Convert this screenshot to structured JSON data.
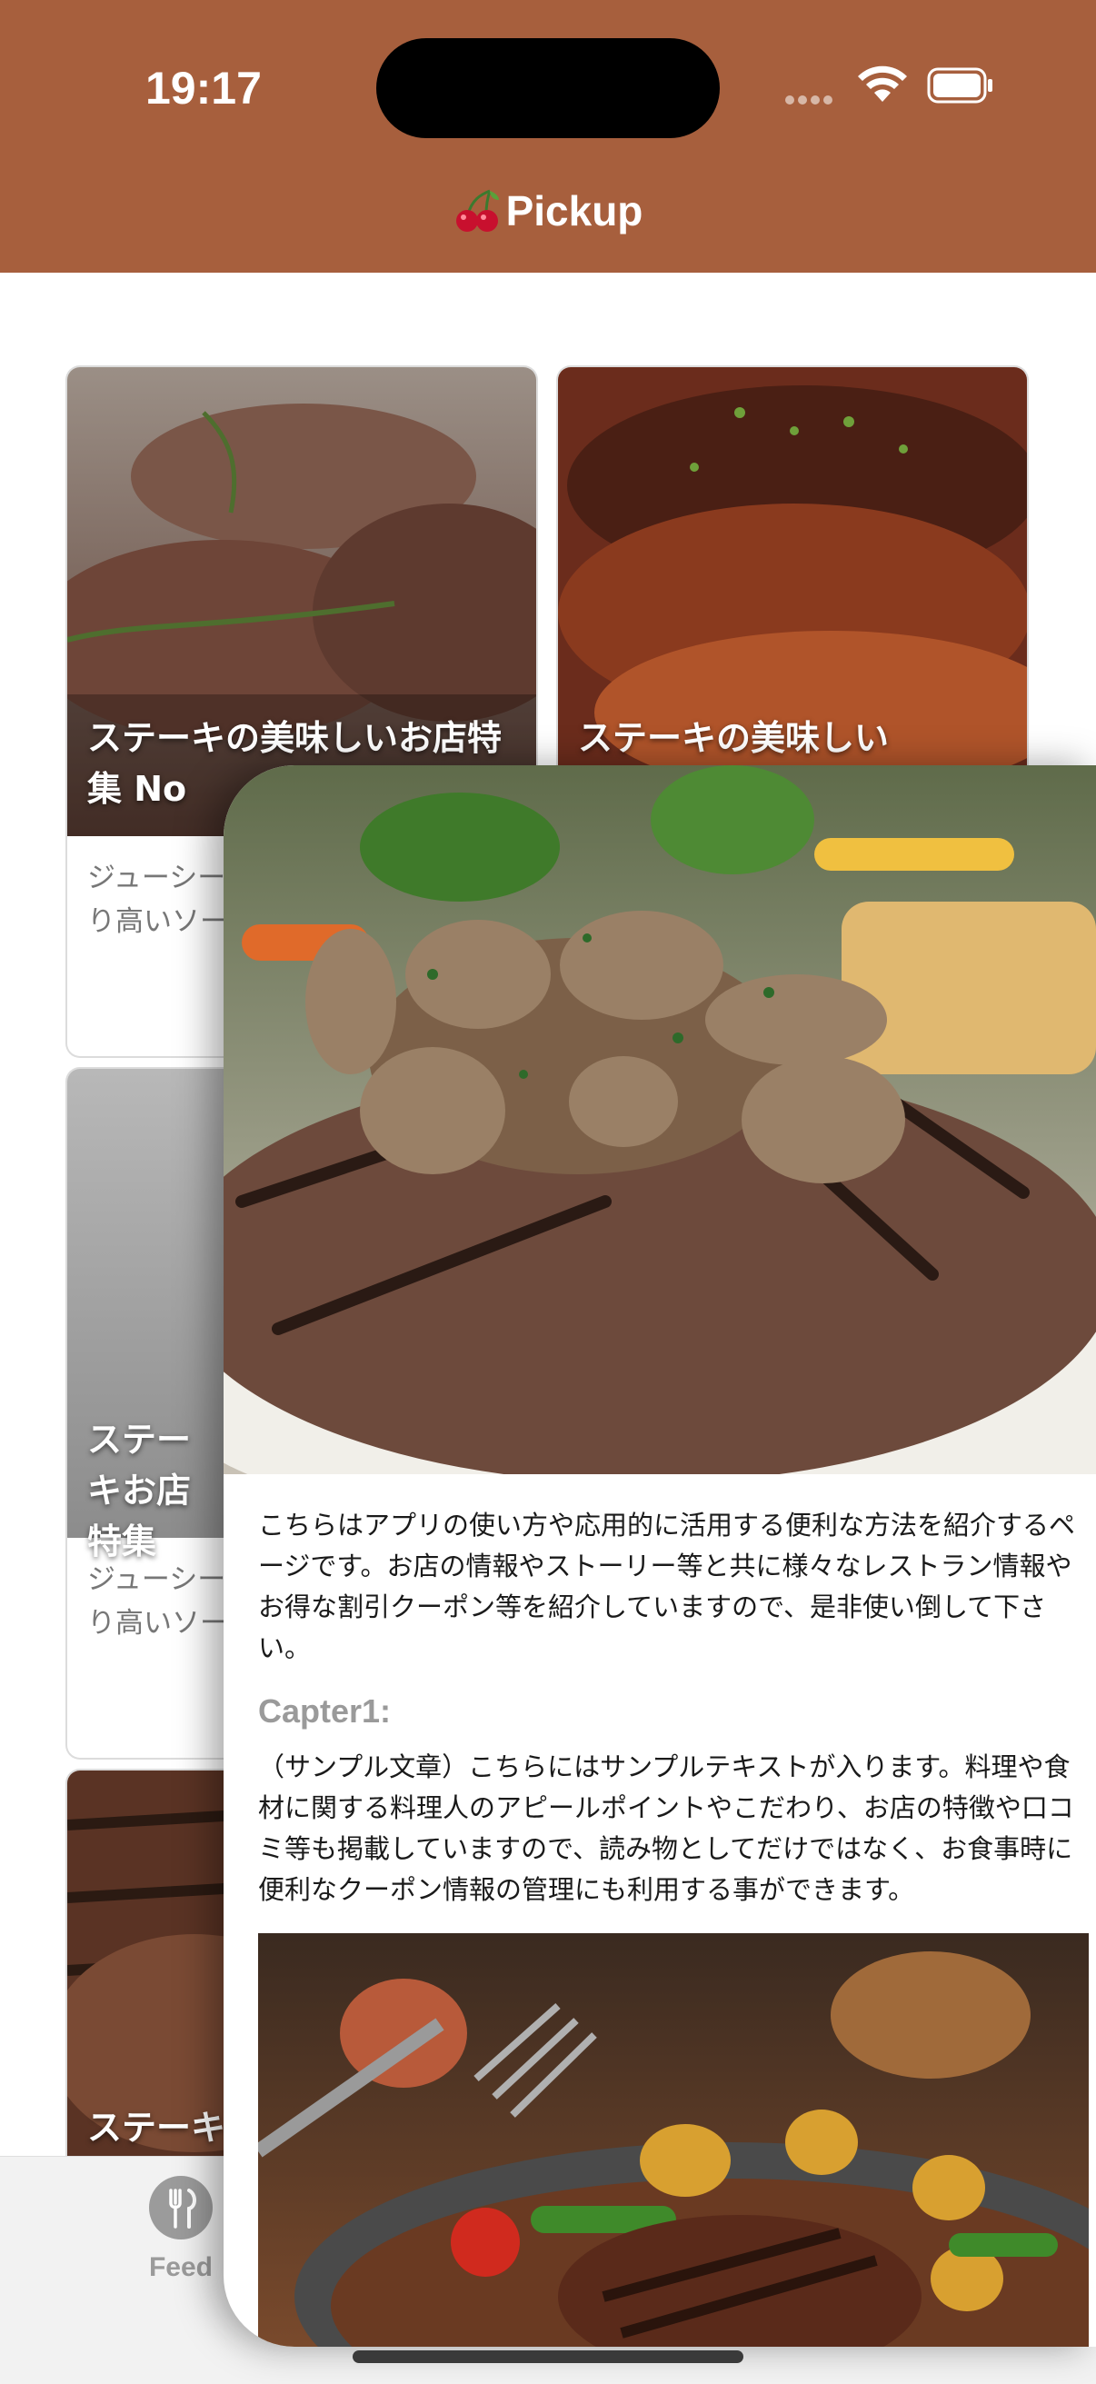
{
  "status": {
    "time": "19:17"
  },
  "nav": {
    "title": "Pickup"
  },
  "cards": [
    {
      "title": "ステーキの美味しいお店特集 No",
      "desc": "ジューシー能できる人き必見の注り高いソー"
    },
    {
      "title": "ステーキの美味しい"
    },
    {
      "title": "ステーキお店特集",
      "desc": "ジューシー能できる人き必見の注り高いソー"
    },
    {
      "title": "ステーキ"
    }
  ],
  "tabbar": {
    "feed_label": "Feed",
    "feed_icon": "fork-knife-icon"
  },
  "sheet": {
    "intro": "こちらはアプリの使い方や応用的に活用する便利な方法を紹介するページです。お店の情報やストーリー等と共に様々なレストラン情報やお得な割引クーポン等を紹介していますので、是非使い倒して下さい。",
    "chapter_title": "Capter1:",
    "chapter_body": "（サンプル文章）こちらにはサンプルテキストが入ります。料理や食材に関する料理人のアピールポイントやこだわり、お店の特徴や口コミ等も掲載していますので、読み物としてだけではなく、お食事時に便利なクーポン情報の管理にも利用する事ができます。"
  },
  "colors": {
    "header": "#a75f3d",
    "accent_text": "#9a9a9a"
  }
}
